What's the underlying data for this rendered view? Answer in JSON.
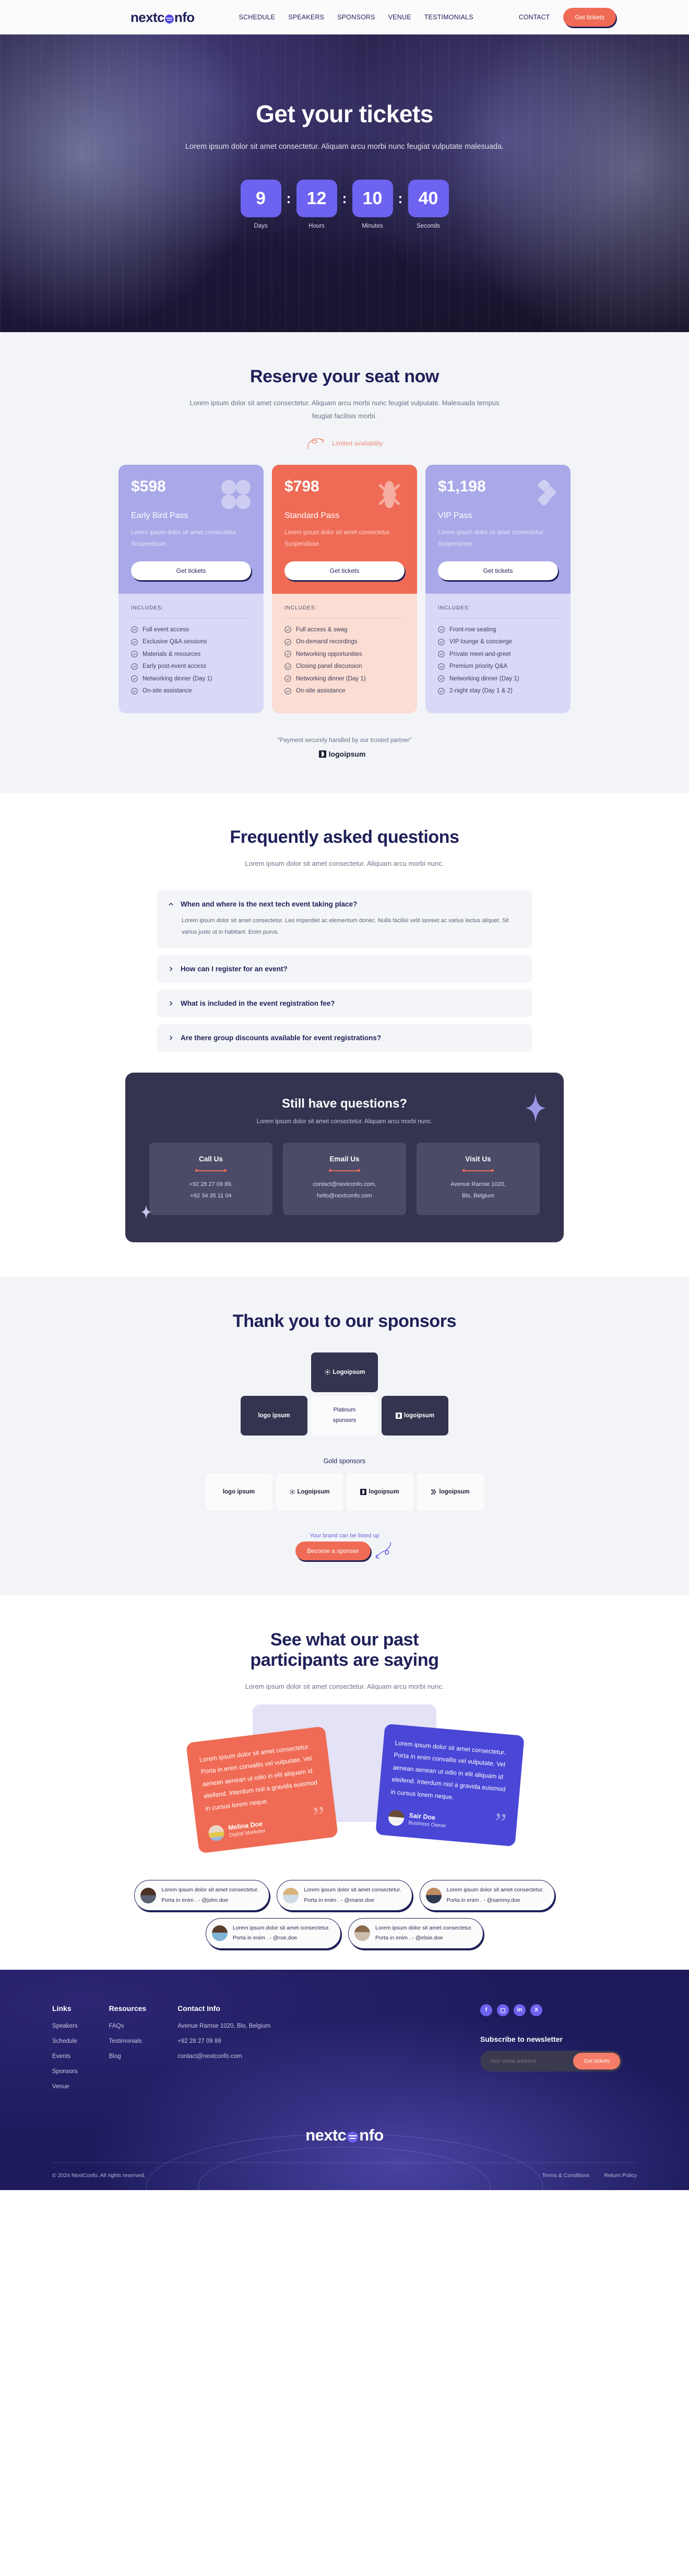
{
  "nav": {
    "brand": "nextconfo",
    "links": [
      "SCHEDULE",
      "SPEAKERS",
      "SPONSORS",
      "VENUE",
      "TESTIMONIALS"
    ],
    "contact": "CONTACT",
    "cta": "Get tickets"
  },
  "hero": {
    "title": "Get your tickets",
    "subtitle": "Lorem ipsum dolor sit amet consectetur. Aliquam arcu morbi nunc feugiat vulputate malesuada.",
    "countdown": [
      {
        "value": "9",
        "label": "Days"
      },
      {
        "value": "12",
        "label": "Hours"
      },
      {
        "value": "10",
        "label": "Minutes"
      },
      {
        "value": "40",
        "label": "Seconds"
      }
    ],
    "separator": ":"
  },
  "pricing": {
    "title": "Reserve your seat now",
    "subtitle": "Lorem ipsum dolor sit amet consectetur. Aliquam arcu morbi nunc feugiat vulputate. Malesuada tempus feugiat facilisis morbi.",
    "badge": "Limited availability",
    "includes_label": "INCLUDES:",
    "cards": [
      {
        "price": "$598",
        "name": "Early Bird Pass",
        "desc": "Lorem ipsum dolor sit amet consectetur. Suspendisse.",
        "cta": "Get tickets",
        "features": [
          "Full event access",
          "Exclusive Q&A sessions",
          "Materials & resources",
          "Early post-event access",
          "Networking dinner (Day 1)",
          "On-site assistance"
        ]
      },
      {
        "price": "$798",
        "name": "Standard Pass",
        "desc": "Lorem ipsum dolor sit amet consectetur. Suspendisse.",
        "cta": "Get tickets",
        "features": [
          "Full access & swag",
          "On-demand recordings",
          "Networking opportunities",
          "Closing panel discussion",
          "Networking dinner (Day 1)",
          "On-site assistance"
        ]
      },
      {
        "price": "$1,198",
        "name": "VIP Pass",
        "desc": "Lorem ipsum dolor sit amet consectetur. Suspendisse.",
        "cta": "Get tickets",
        "features": [
          "Front-row seating",
          "VIP lounge & concierge",
          "Private meet-and-greet",
          "Premium priority Q&A",
          "Networking dinner (Day 1)",
          "2-night stay (Day 1 & 2)"
        ]
      }
    ],
    "payment_note": "\"Payment securely handled by our trusted partner\"",
    "payment_partner": "logoipsum"
  },
  "faq": {
    "title": "Frequently asked questions",
    "subtitle": "Lorem ipsum dolor sit amet consectetur. Aliquam arcu morbi nunc.",
    "items": [
      {
        "q": "When and where is the next tech event taking place?",
        "a": "Lorem ipsum dolor sit amet consectetur. Leo imperdiet ac elementum donec. Nulla facilisi velit laoreet ac varius lectus aliquet. Sit varius justo ut in habitant. Enim purus.",
        "open": true
      },
      {
        "q": "How can I register for an event?",
        "a": "",
        "open": false
      },
      {
        "q": "What is included in the event registration fee?",
        "a": "",
        "open": false
      },
      {
        "q": "Are there group discounts available for event registrations?",
        "a": "",
        "open": false
      }
    ],
    "contact_card": {
      "title": "Still have questions?",
      "subtitle": "Lorem ipsum dolor sit amet consectetur. Aliquam arcu morbi nunc.",
      "boxes": [
        {
          "label": "Call Us",
          "line1": "+92 28 27 09 89,",
          "line2": "+92 34 35 11 04"
        },
        {
          "label": "Email Us",
          "line1": "contact@nextconfo.com,",
          "line2": "hello@nextconfo.com"
        },
        {
          "label": "Visit Us",
          "line1": "Avenue Ramse 1020,",
          "line2": "Blo, Belgium"
        }
      ]
    }
  },
  "sponsors": {
    "title": "Thank you to our sponsors",
    "platinum_label_line1": "Platinum",
    "platinum_label_line2": "sponsors",
    "platinum": [
      {
        "text": "Logoipsum",
        "mark": "sunburst",
        "dark": true
      },
      {
        "text": "logo ipsum",
        "mark": "globe",
        "dark": true
      },
      {
        "text": "logoipsum",
        "mark": "halfmoon",
        "dark": true
      }
    ],
    "gold_label": "Gold sponsors",
    "gold": [
      {
        "text": "logo ipsum",
        "mark": "globe"
      },
      {
        "text": "Logoipsum",
        "mark": "sunburst"
      },
      {
        "text": "logoipsum",
        "mark": "halfmoon"
      },
      {
        "text": "logoipsum",
        "mark": "dots"
      }
    ],
    "brand_note": "Your brand can be listed up",
    "cta": "Become a sponser"
  },
  "testimonials": {
    "title_line1": "See what our past",
    "title_line2": "participants are saying",
    "subtitle": "Lorem ipsum dolor sit amet consectetur. Aliquam arcu morbi nunc.",
    "cards": [
      {
        "quote": "Lorem ipsum dolor sit amet consectetur. Porta in enim convallis vel vulputate. Vel aenean aenean ut odio in elit aliquam id eleifend. Interdum nisl a gravida euismod in cursus lorem neque.",
        "name": "Melina Doe",
        "role": "Digital Marketer"
      },
      {
        "quote": "Lorem ipsum dolor sit amet consectetur. Porta in enim convallis vel vulputate. Vel aenean aenean ut odio in elit aliquam id eleifend. Interdum nisl a gravida euismod in cursus lorem neque.",
        "name": "Sair Doe",
        "role": "Business Owner"
      }
    ],
    "pills_row1": [
      {
        "line1": "Lorem ipsum dolor sit amet consectetur.",
        "line2": "Porta in enim . - @john.doe"
      },
      {
        "line1": "Lorem ipsum dolor sit amet consectetur.",
        "line2": "Porta in enim . - @marie.doe"
      },
      {
        "line1": "Lorem ipsum dolor sit amet consectetur.",
        "line2": "Porta in enim . - @sammy.doe"
      }
    ],
    "pills_row2": [
      {
        "line1": "Lorem ipsum dolor sit amet consectetur.",
        "line2": "Porta in enim . - @roe.doe"
      },
      {
        "line1": "Lorem ipsum dolor sit amet consectetur.",
        "line2": "Porta in enim . - @elsie.doe"
      }
    ]
  },
  "footer": {
    "links_title": "Links",
    "links": [
      "Speakers",
      "Schedule",
      "Events",
      "Sponsors",
      "Venue"
    ],
    "resources_title": "Resources",
    "resources": [
      "FAQs",
      "Testimonials",
      "Blog"
    ],
    "contact_title": "Contact Info",
    "contact": [
      "Avenue Ramse 1020, Blo, Belgium",
      "+92 28 27 09 89",
      "contact@nextconfo.com"
    ],
    "socials": [
      "f",
      "▢",
      "in",
      "X"
    ],
    "subscribe_title": "Subscribe to newsletter",
    "email_placeholder": "Your email address",
    "subscribe_cta": "Get tickets",
    "brand": "nextconfo",
    "copyright": "© 2024 NextConfo. All rights reserved.",
    "bottom_links": [
      "Terms & Conditions",
      "Return Policy"
    ]
  },
  "colors": {
    "accent_orange": "#ef6b55",
    "accent_purple": "#6d63f0",
    "navy": "#1e2059",
    "card_lilac": "#a9a8e8"
  }
}
